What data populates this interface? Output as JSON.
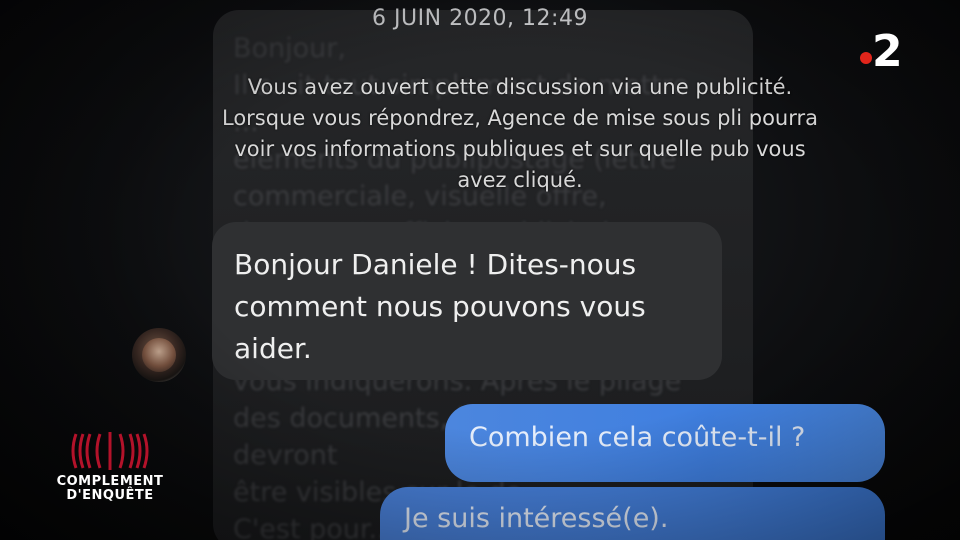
{
  "conversation": {
    "date": "6 JUIN 2020, 12:49",
    "info_notice": "Vous avez ouvert cette discussion via une publicité. Lorsque vous répondrez, Agence de mise sous pli pourra voir vos informations publiques et sur quelle pub vous avez cliqué.",
    "received_message": "Bonjour Daniele ! Dites-nous comment nous pouvons vous aider.",
    "sent_messages": [
      "Combien cela coûte-t-il ?",
      "Je suis intéressé(e)."
    ],
    "background_text": "Bonjour,\nIl s...it tout simplement de mettre\n...\néléments du publipostage (lettre\ncommerciale, visuelle offre,\ndocument, affiche publicitaire\nretour, etc.) à y coller des\nétiquettes et à les plier par la suite\nselon un modèle de pli que nous\nvous indiquerons. Après le pliage\ndes documents, les étiquettes\ndevront\nêtre visibles sur le do...\nC'est pour..."
  },
  "overlay": {
    "channel_logo": "2",
    "program_logo_line1": "COMPLEMENT",
    "program_logo_line2": "D'ENQUÊTE"
  },
  "colors": {
    "sent_bubble": "#3f7fe0",
    "received_bubble": "#2f3032",
    "channel_dot": "#e1251b"
  }
}
